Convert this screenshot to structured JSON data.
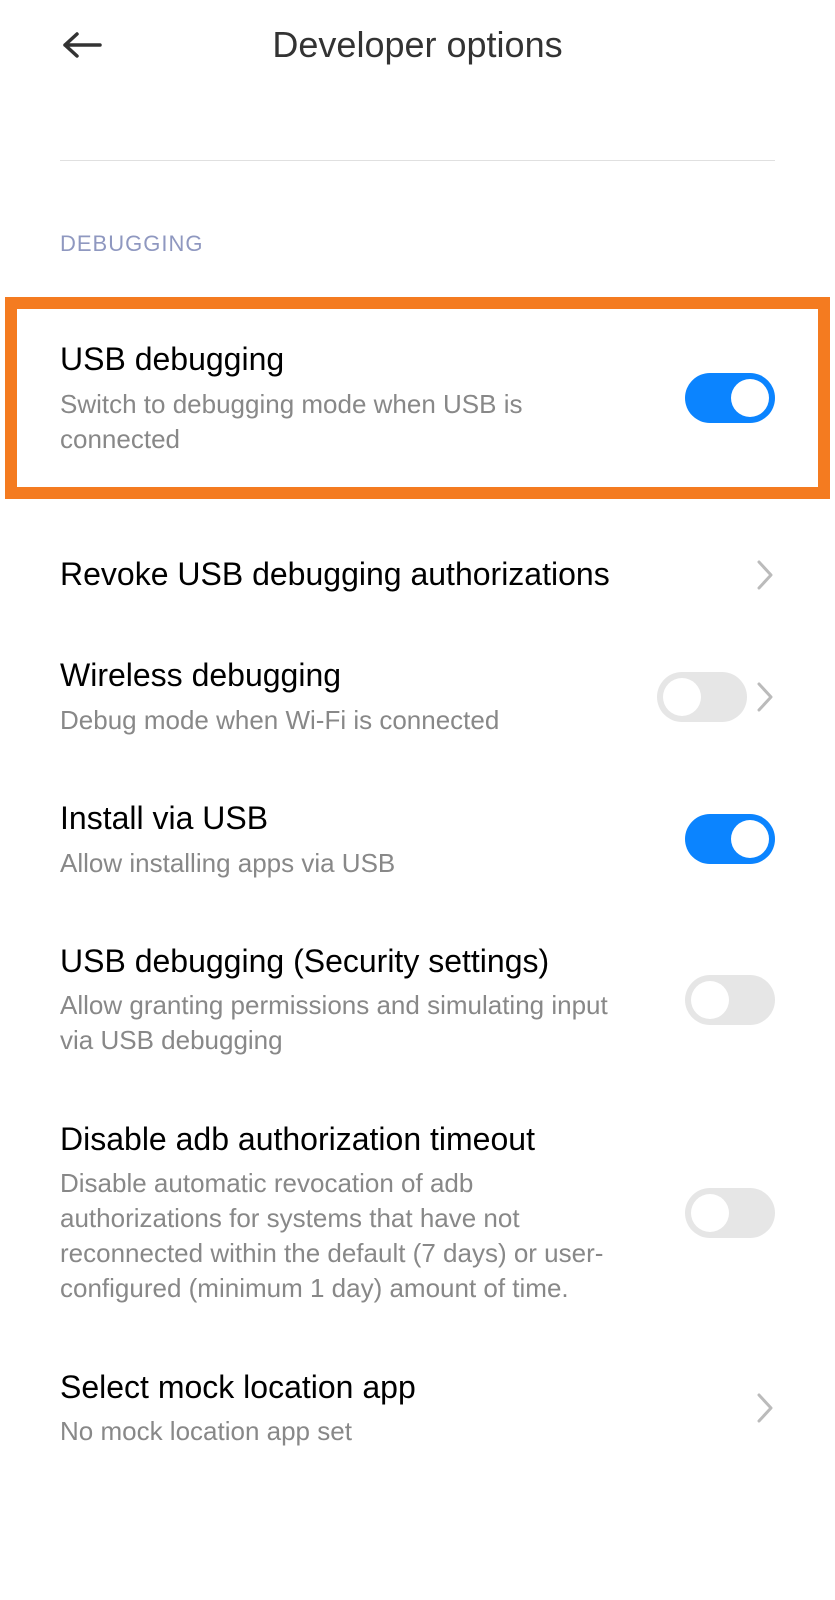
{
  "header": {
    "title": "Developer options"
  },
  "section": {
    "label": "DEBUGGING"
  },
  "settings": {
    "usb_debugging": {
      "title": "USB debugging",
      "subtitle": "Switch to debugging mode when USB is connected",
      "enabled": true
    },
    "revoke": {
      "title": "Revoke USB debugging authorizations"
    },
    "wireless": {
      "title": "Wireless debugging",
      "subtitle": "Debug mode when Wi-Fi is connected",
      "enabled": false
    },
    "install_usb": {
      "title": "Install via USB",
      "subtitle": "Allow installing apps via USB",
      "enabled": true
    },
    "security": {
      "title": "USB debugging (Security settings)",
      "subtitle": "Allow granting permissions and simulating input via USB debugging",
      "enabled": false
    },
    "adb_timeout": {
      "title": "Disable adb authorization timeout",
      "subtitle": "Disable automatic revocation of adb authorizations for systems that have not reconnected within the default (7 days) or user-configured (minimum 1 day) amount of time.",
      "enabled": false
    },
    "mock_location": {
      "title": "Select mock location app",
      "subtitle": "No mock location app set"
    }
  },
  "colors": {
    "accent": "#0b84ff",
    "highlight_border": "#f47b20"
  }
}
